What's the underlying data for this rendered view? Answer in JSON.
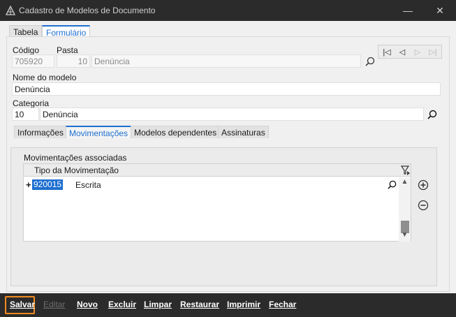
{
  "window": {
    "title": "Cadastro de Modelos de Documento",
    "minimize_label": "—",
    "close_label": "✕"
  },
  "outer_tabs": [
    {
      "label": "Tabela",
      "active": false
    },
    {
      "label": "Formulário",
      "active": true
    }
  ],
  "form": {
    "codigo_label": "Código",
    "codigo_value": "705920",
    "pasta_label": "Pasta",
    "pasta_number": "10",
    "pasta_name": "Denúncia",
    "nome_label": "Nome do modelo",
    "nome_value": "Denúncia",
    "categoria_label": "Categoria",
    "categoria_code": "10",
    "categoria_name": "Denúncia"
  },
  "record_nav": {
    "first": "|◁",
    "prev": "◁",
    "next": "▷",
    "last": "▷|"
  },
  "inner_tabs": [
    {
      "label": "Informações",
      "active": false
    },
    {
      "label": "Movimentações",
      "active": true
    },
    {
      "label": "Modelos dependentes",
      "active": false
    },
    {
      "label": "Assinaturas",
      "active": false
    }
  ],
  "movimentacoes": {
    "section_label": "Movimentações associadas",
    "column_header": "Tipo da Movimentação",
    "rows": [
      {
        "expand": "+",
        "code": "920015",
        "name": "Escrita"
      }
    ]
  },
  "commands": [
    {
      "label": "Salvar",
      "enabled": true
    },
    {
      "label": "Editar",
      "enabled": false
    },
    {
      "label": "Novo",
      "enabled": true
    },
    {
      "label": "Excluir",
      "enabled": true
    },
    {
      "label": "Limpar",
      "enabled": true
    },
    {
      "label": "Restaurar",
      "enabled": true
    },
    {
      "label": "Imprimir",
      "enabled": true
    },
    {
      "label": "Fechar",
      "enabled": true
    }
  ],
  "colors": {
    "accent": "#1e6fd0",
    "focus_outline": "#f28a1e",
    "titlebar": "#2b2b2b",
    "selection": "#1e6fd0"
  }
}
